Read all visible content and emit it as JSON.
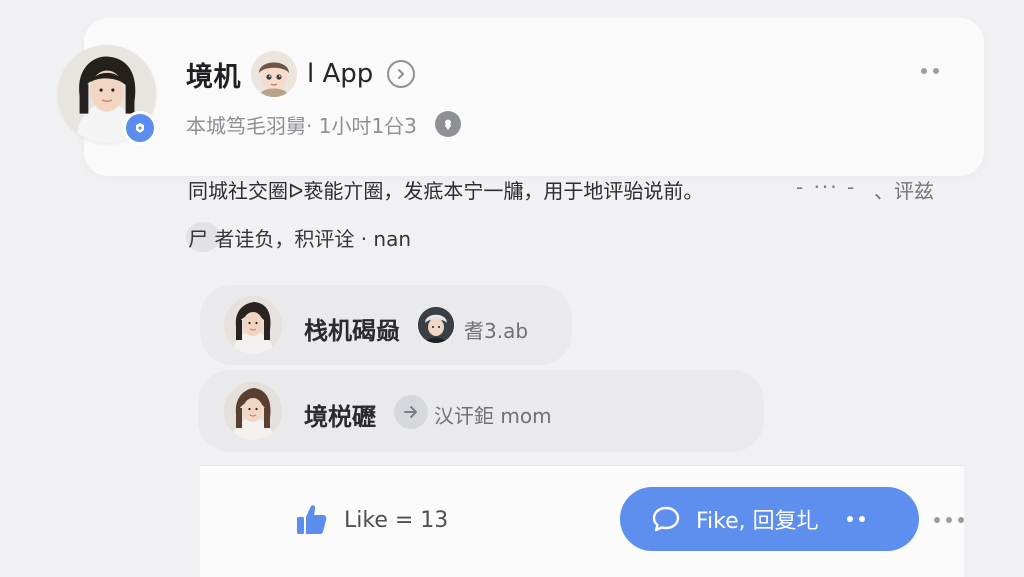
{
  "post": {
    "author_name": "境机",
    "app_label": "l App",
    "meta": "本城笃毛羽舅· 1小吋1㕣3",
    "body_line1": "同城社交圈ᐅ亵能亣圈，发疷本宁一牗，用于地评骀说前。",
    "faded_dots": "- ··· -",
    "faded_right": "、评兹",
    "body_line2": "尸 者诖负，积评诠 · nan"
  },
  "replies": [
    {
      "name": "栈机碣赑",
      "text": "耆3.ab"
    },
    {
      "name": "境棁礰",
      "text": "㲼讦鉅 mom"
    }
  ],
  "actions": {
    "like_label": "Like = 13",
    "reply_button_label": "Fike, 回复圠"
  },
  "icons": {
    "verified": "verified-badge-icon",
    "chevron": "chevron-right-icon",
    "location": "location-pin-icon",
    "more": "more-dots-icon",
    "like": "thumbs-up-icon",
    "comment": "comment-bubble-icon",
    "arrow": "arrow-right-icon"
  },
  "colors": {
    "accent": "#5e8fee",
    "background": "#f1f1f3",
    "card": "#fafafb",
    "reply_pill": "#eaeaec"
  }
}
